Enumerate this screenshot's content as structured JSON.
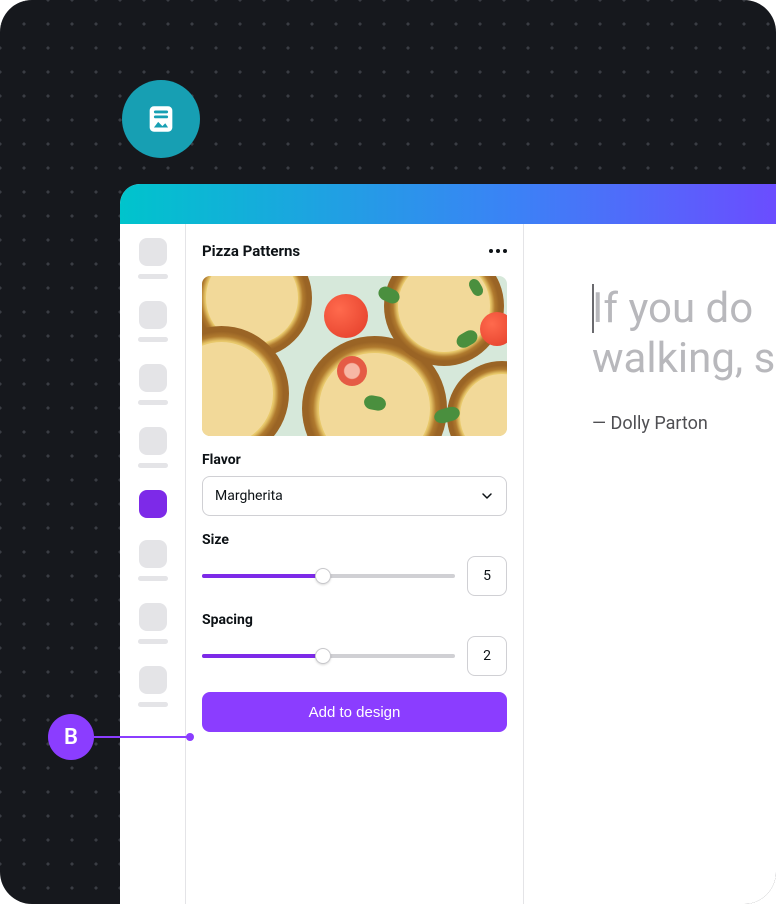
{
  "badge": {
    "icon": "document-image-icon"
  },
  "panel": {
    "title": "Pizza Patterns",
    "flavor": {
      "label": "Flavor",
      "value": "Margherita"
    },
    "size": {
      "label": "Size",
      "value": "5",
      "percent": 48
    },
    "spacing": {
      "label": "Spacing",
      "value": "2",
      "percent": 48
    },
    "cta_label": "Add to design"
  },
  "rail": {
    "active_index": 4
  },
  "canvas": {
    "quote_line1": "If you do",
    "quote_line2": "walking, s",
    "attribution": "— Dolly Parton"
  },
  "annotation": {
    "letter": "B"
  }
}
